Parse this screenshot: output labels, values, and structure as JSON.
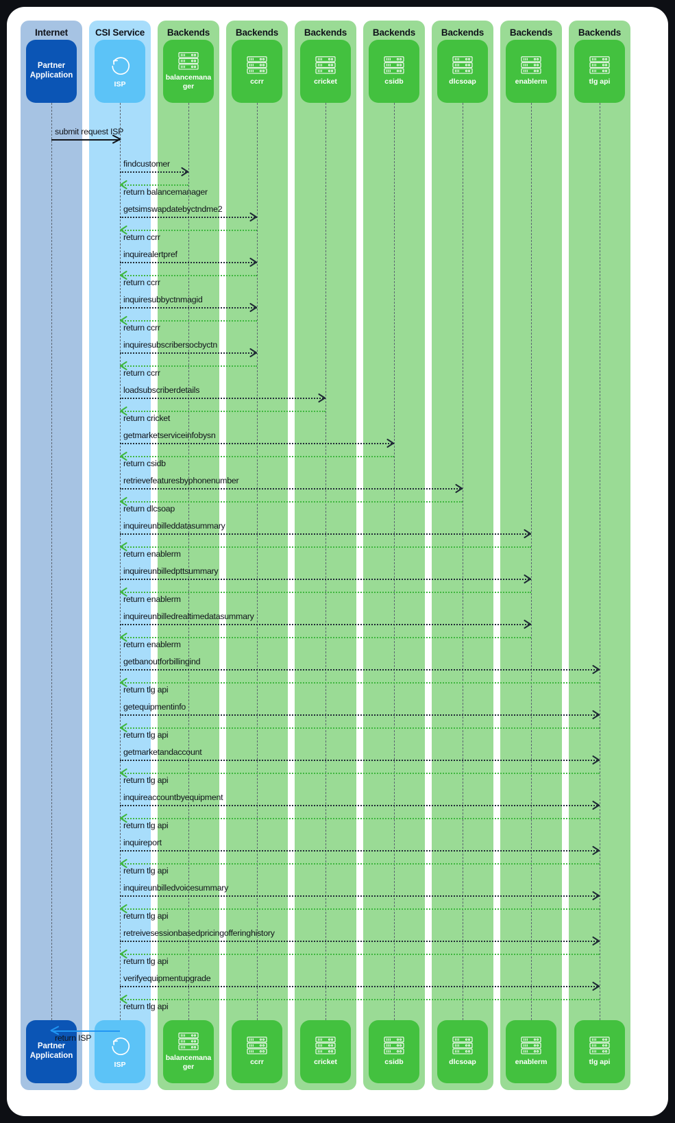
{
  "diagram": {
    "type": "sequence-diagram",
    "title": "CSI Service ISP sequence",
    "colors": {
      "internet_lane": "#a6c3e3",
      "internet_box": "#0b55b5",
      "csi_lane": "#a8ddfb",
      "csi_box": "#5cc3f7",
      "backend_lane": "#9adb95",
      "backend_box": "#42c game",
      "backend_box_hex": "#43c13f",
      "request_arrow": "#1f2a35",
      "return_arrow": "#3fb63f",
      "entry_arrow": "#101318",
      "exit_arrow": "#2196f3",
      "lifeline": "#5b6470",
      "card": "#ffffff",
      "page": "#0d0f14"
    },
    "lanes": [
      {
        "title": "Internet",
        "participant": "Partner Application",
        "icon": "none",
        "kind": "internet"
      },
      {
        "title": "CSI Service",
        "participant": "ISP",
        "icon": "refresh-icon",
        "kind": "csi"
      },
      {
        "title": "Backends",
        "participant": "balancemanager",
        "icon": "server-icon",
        "kind": "backend"
      },
      {
        "title": "Backends",
        "participant": "ccrr",
        "icon": "server-icon",
        "kind": "backend"
      },
      {
        "title": "Backends",
        "participant": "cricket",
        "icon": "server-icon",
        "kind": "backend"
      },
      {
        "title": "Backends",
        "participant": "csidb",
        "icon": "server-icon",
        "kind": "backend"
      },
      {
        "title": "Backends",
        "participant": "dlcsoap",
        "icon": "server-icon",
        "kind": "backend"
      },
      {
        "title": "Backends",
        "participant": "enablerm",
        "icon": "server-icon",
        "kind": "backend"
      },
      {
        "title": "Backends",
        "participant": "tlg api",
        "icon": "server-icon",
        "kind": "backend"
      }
    ],
    "messages": [
      {
        "label": "submit request ISP",
        "from": 0,
        "to": 1,
        "style": "solid-req",
        "dir": "right",
        "labelpos": "above"
      },
      {
        "label": "findcustomer",
        "from": 1,
        "to": 2,
        "style": "req",
        "dir": "right",
        "labelpos": "above"
      },
      {
        "label": "return balancemanager",
        "from": 2,
        "to": 1,
        "style": "ret",
        "dir": "left",
        "labelpos": "below"
      },
      {
        "label": "getsimswapdatebyctndme2",
        "from": 1,
        "to": 3,
        "style": "req",
        "dir": "right",
        "labelpos": "above"
      },
      {
        "label": "return ccrr",
        "from": 3,
        "to": 1,
        "style": "ret",
        "dir": "left",
        "labelpos": "below"
      },
      {
        "label": "inquirealertpref",
        "from": 1,
        "to": 3,
        "style": "req",
        "dir": "right",
        "labelpos": "above"
      },
      {
        "label": "return ccrr",
        "from": 3,
        "to": 1,
        "style": "ret",
        "dir": "left",
        "labelpos": "below"
      },
      {
        "label": "inquiresubbyctnmagid",
        "from": 1,
        "to": 3,
        "style": "req",
        "dir": "right",
        "labelpos": "above"
      },
      {
        "label": "return ccrr",
        "from": 3,
        "to": 1,
        "style": "ret",
        "dir": "left",
        "labelpos": "below"
      },
      {
        "label": "inquiresubscribersocbyctn",
        "from": 1,
        "to": 3,
        "style": "req",
        "dir": "right",
        "labelpos": "above"
      },
      {
        "label": "return ccrr",
        "from": 3,
        "to": 1,
        "style": "ret",
        "dir": "left",
        "labelpos": "below"
      },
      {
        "label": "loadsubscriberdetails",
        "from": 1,
        "to": 4,
        "style": "req",
        "dir": "right",
        "labelpos": "above"
      },
      {
        "label": "return cricket",
        "from": 4,
        "to": 1,
        "style": "ret",
        "dir": "left",
        "labelpos": "below"
      },
      {
        "label": "getmarketserviceinfobysn",
        "from": 1,
        "to": 5,
        "style": "req",
        "dir": "right",
        "labelpos": "above"
      },
      {
        "label": "return csidb",
        "from": 5,
        "to": 1,
        "style": "ret",
        "dir": "left",
        "labelpos": "below"
      },
      {
        "label": "retrievefeaturesbyphonenumber",
        "from": 1,
        "to": 6,
        "style": "req",
        "dir": "right",
        "labelpos": "above"
      },
      {
        "label": "return dlcsoap",
        "from": 6,
        "to": 1,
        "style": "ret",
        "dir": "left",
        "labelpos": "below"
      },
      {
        "label": "inquireunbilleddatasummary",
        "from": 1,
        "to": 7,
        "style": "req",
        "dir": "right",
        "labelpos": "above"
      },
      {
        "label": "return enablerm",
        "from": 7,
        "to": 1,
        "style": "ret",
        "dir": "left",
        "labelpos": "below"
      },
      {
        "label": "inquireunbilledpttsummary",
        "from": 1,
        "to": 7,
        "style": "req",
        "dir": "right",
        "labelpos": "above"
      },
      {
        "label": "return enablerm",
        "from": 7,
        "to": 1,
        "style": "ret",
        "dir": "left",
        "labelpos": "below"
      },
      {
        "label": "inquireunbilledrealtimedatasummary",
        "from": 1,
        "to": 7,
        "style": "req",
        "dir": "right",
        "labelpos": "above"
      },
      {
        "label": "return enablerm",
        "from": 7,
        "to": 1,
        "style": "ret",
        "dir": "left",
        "labelpos": "below"
      },
      {
        "label": "getbanoutforbillingind",
        "from": 1,
        "to": 8,
        "style": "req",
        "dir": "right",
        "labelpos": "above"
      },
      {
        "label": "return tlg api",
        "from": 8,
        "to": 1,
        "style": "ret",
        "dir": "left",
        "labelpos": "below"
      },
      {
        "label": "getequipmentinfo",
        "from": 1,
        "to": 8,
        "style": "req",
        "dir": "right",
        "labelpos": "above"
      },
      {
        "label": "return tlg api",
        "from": 8,
        "to": 1,
        "style": "ret",
        "dir": "left",
        "labelpos": "below"
      },
      {
        "label": "getmarketandaccount",
        "from": 1,
        "to": 8,
        "style": "req",
        "dir": "right",
        "labelpos": "above"
      },
      {
        "label": "return tlg api",
        "from": 8,
        "to": 1,
        "style": "ret",
        "dir": "left",
        "labelpos": "below"
      },
      {
        "label": "inquireaccountbyequipment",
        "from": 1,
        "to": 8,
        "style": "req",
        "dir": "right",
        "labelpos": "above"
      },
      {
        "label": "return tlg api",
        "from": 8,
        "to": 1,
        "style": "ret",
        "dir": "left",
        "labelpos": "below"
      },
      {
        "label": "inquireport",
        "from": 1,
        "to": 8,
        "style": "req",
        "dir": "right",
        "labelpos": "above"
      },
      {
        "label": "return tlg api",
        "from": 8,
        "to": 1,
        "style": "ret",
        "dir": "left",
        "labelpos": "below"
      },
      {
        "label": "inquireunbilledvoicesummary",
        "from": 1,
        "to": 8,
        "style": "req",
        "dir": "right",
        "labelpos": "above"
      },
      {
        "label": "return tlg api",
        "from": 8,
        "to": 1,
        "style": "ret",
        "dir": "left",
        "labelpos": "below"
      },
      {
        "label": "retreivesessionbasedpricingofferinghistory",
        "from": 1,
        "to": 8,
        "style": "req",
        "dir": "right",
        "labelpos": "above"
      },
      {
        "label": "return tlg api",
        "from": 8,
        "to": 1,
        "style": "ret",
        "dir": "left",
        "labelpos": "below"
      },
      {
        "label": "verifyequipmentupgrade",
        "from": 1,
        "to": 8,
        "style": "req",
        "dir": "right",
        "labelpos": "above"
      },
      {
        "label": "return tlg api",
        "from": 8,
        "to": 1,
        "style": "ret",
        "dir": "left",
        "labelpos": "below"
      },
      {
        "label": "return ISP",
        "from": 1,
        "to": 0,
        "style": "solid-ret",
        "dir": "left",
        "labelpos": "below"
      }
    ]
  }
}
